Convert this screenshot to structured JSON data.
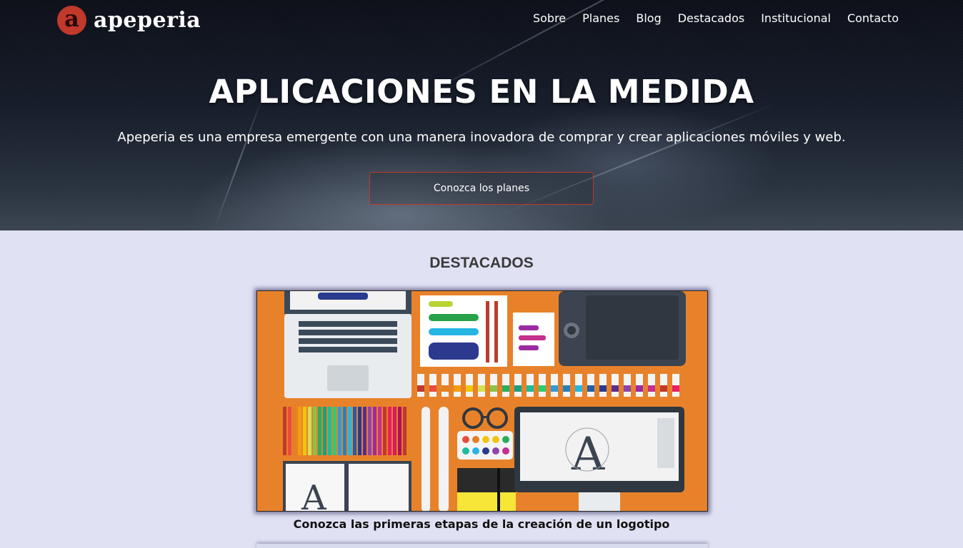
{
  "brand": {
    "logo_letter": "a",
    "name": "apeperia",
    "color": "#c0392b"
  },
  "nav": {
    "items": [
      {
        "label": "Sobre"
      },
      {
        "label": "Planes"
      },
      {
        "label": "Blog"
      },
      {
        "label": "Destacados"
      },
      {
        "label": "Institucional"
      },
      {
        "label": "Contacto"
      }
    ]
  },
  "hero": {
    "title": "APLICACIONES EN LA MEDIDA",
    "subtitle": "Apeperia es una empresa emergente con una manera inovadora de comprar y crear aplicaciones móviles y web.",
    "cta_label": "Conozca los planes"
  },
  "featured": {
    "section_title": "DESTACADOS",
    "items": [
      {
        "caption": "Conozca las primeras etapas de la creación de un logotipo",
        "image_icon": "design-tools-illustration"
      }
    ]
  },
  "colors": {
    "accent": "#c0392b",
    "section_bg": "#e0e2f4",
    "illustration_bg": "#e8822a"
  }
}
